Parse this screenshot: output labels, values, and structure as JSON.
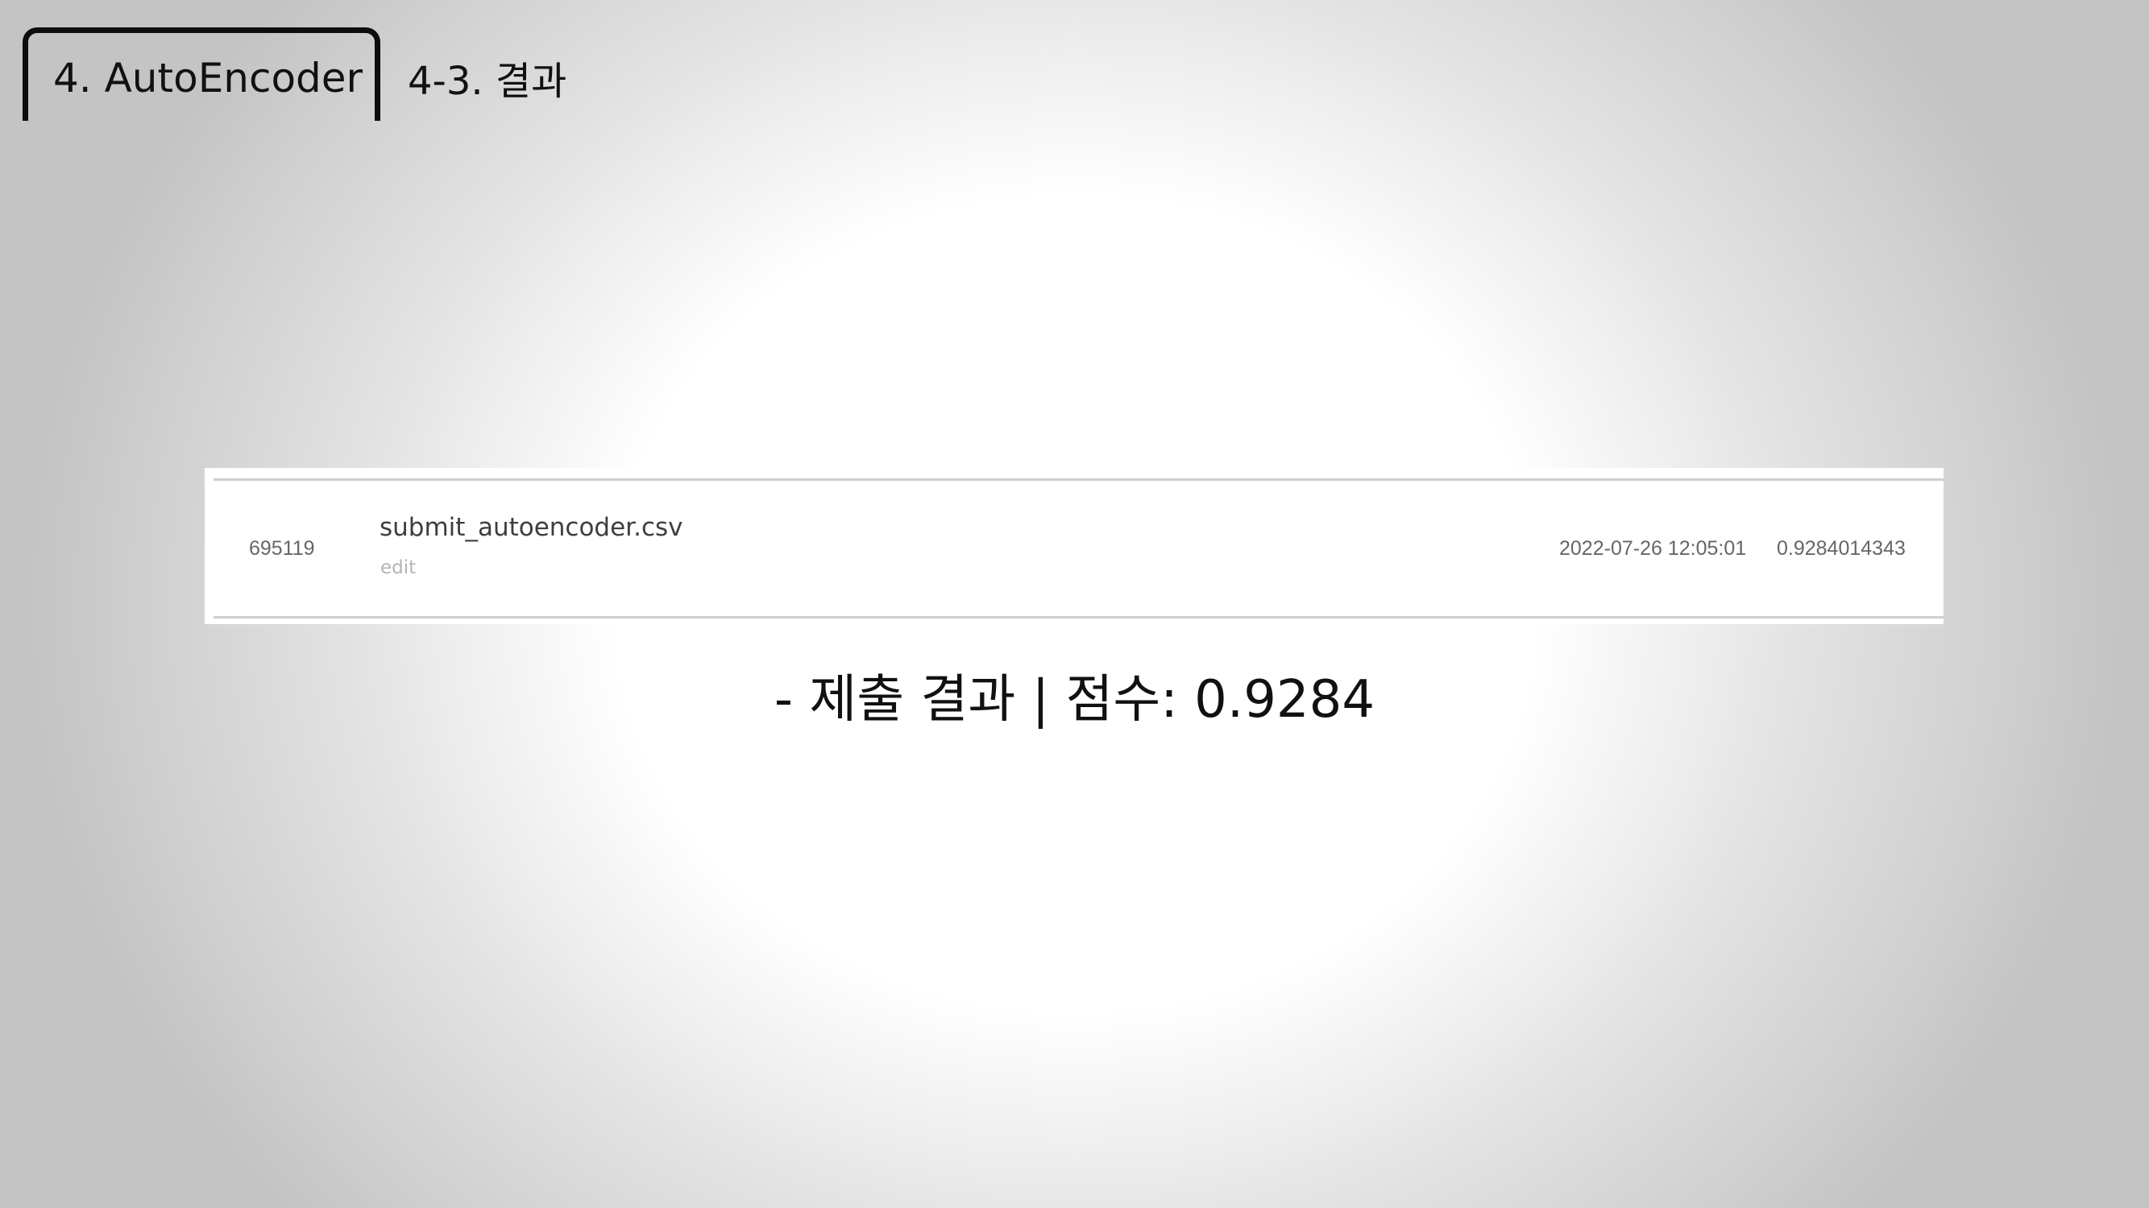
{
  "header": {
    "section_title": "4. AutoEncoder",
    "subsection_title": "4-3. 결과"
  },
  "submission": {
    "id": "695119",
    "file_name": "submit_autoencoder.csv",
    "edit_label": "edit",
    "datetime": "2022-07-26 12:05:01",
    "score": "0.9284014343"
  },
  "caption": "-  제출 결과 | 점수: 0.9284"
}
